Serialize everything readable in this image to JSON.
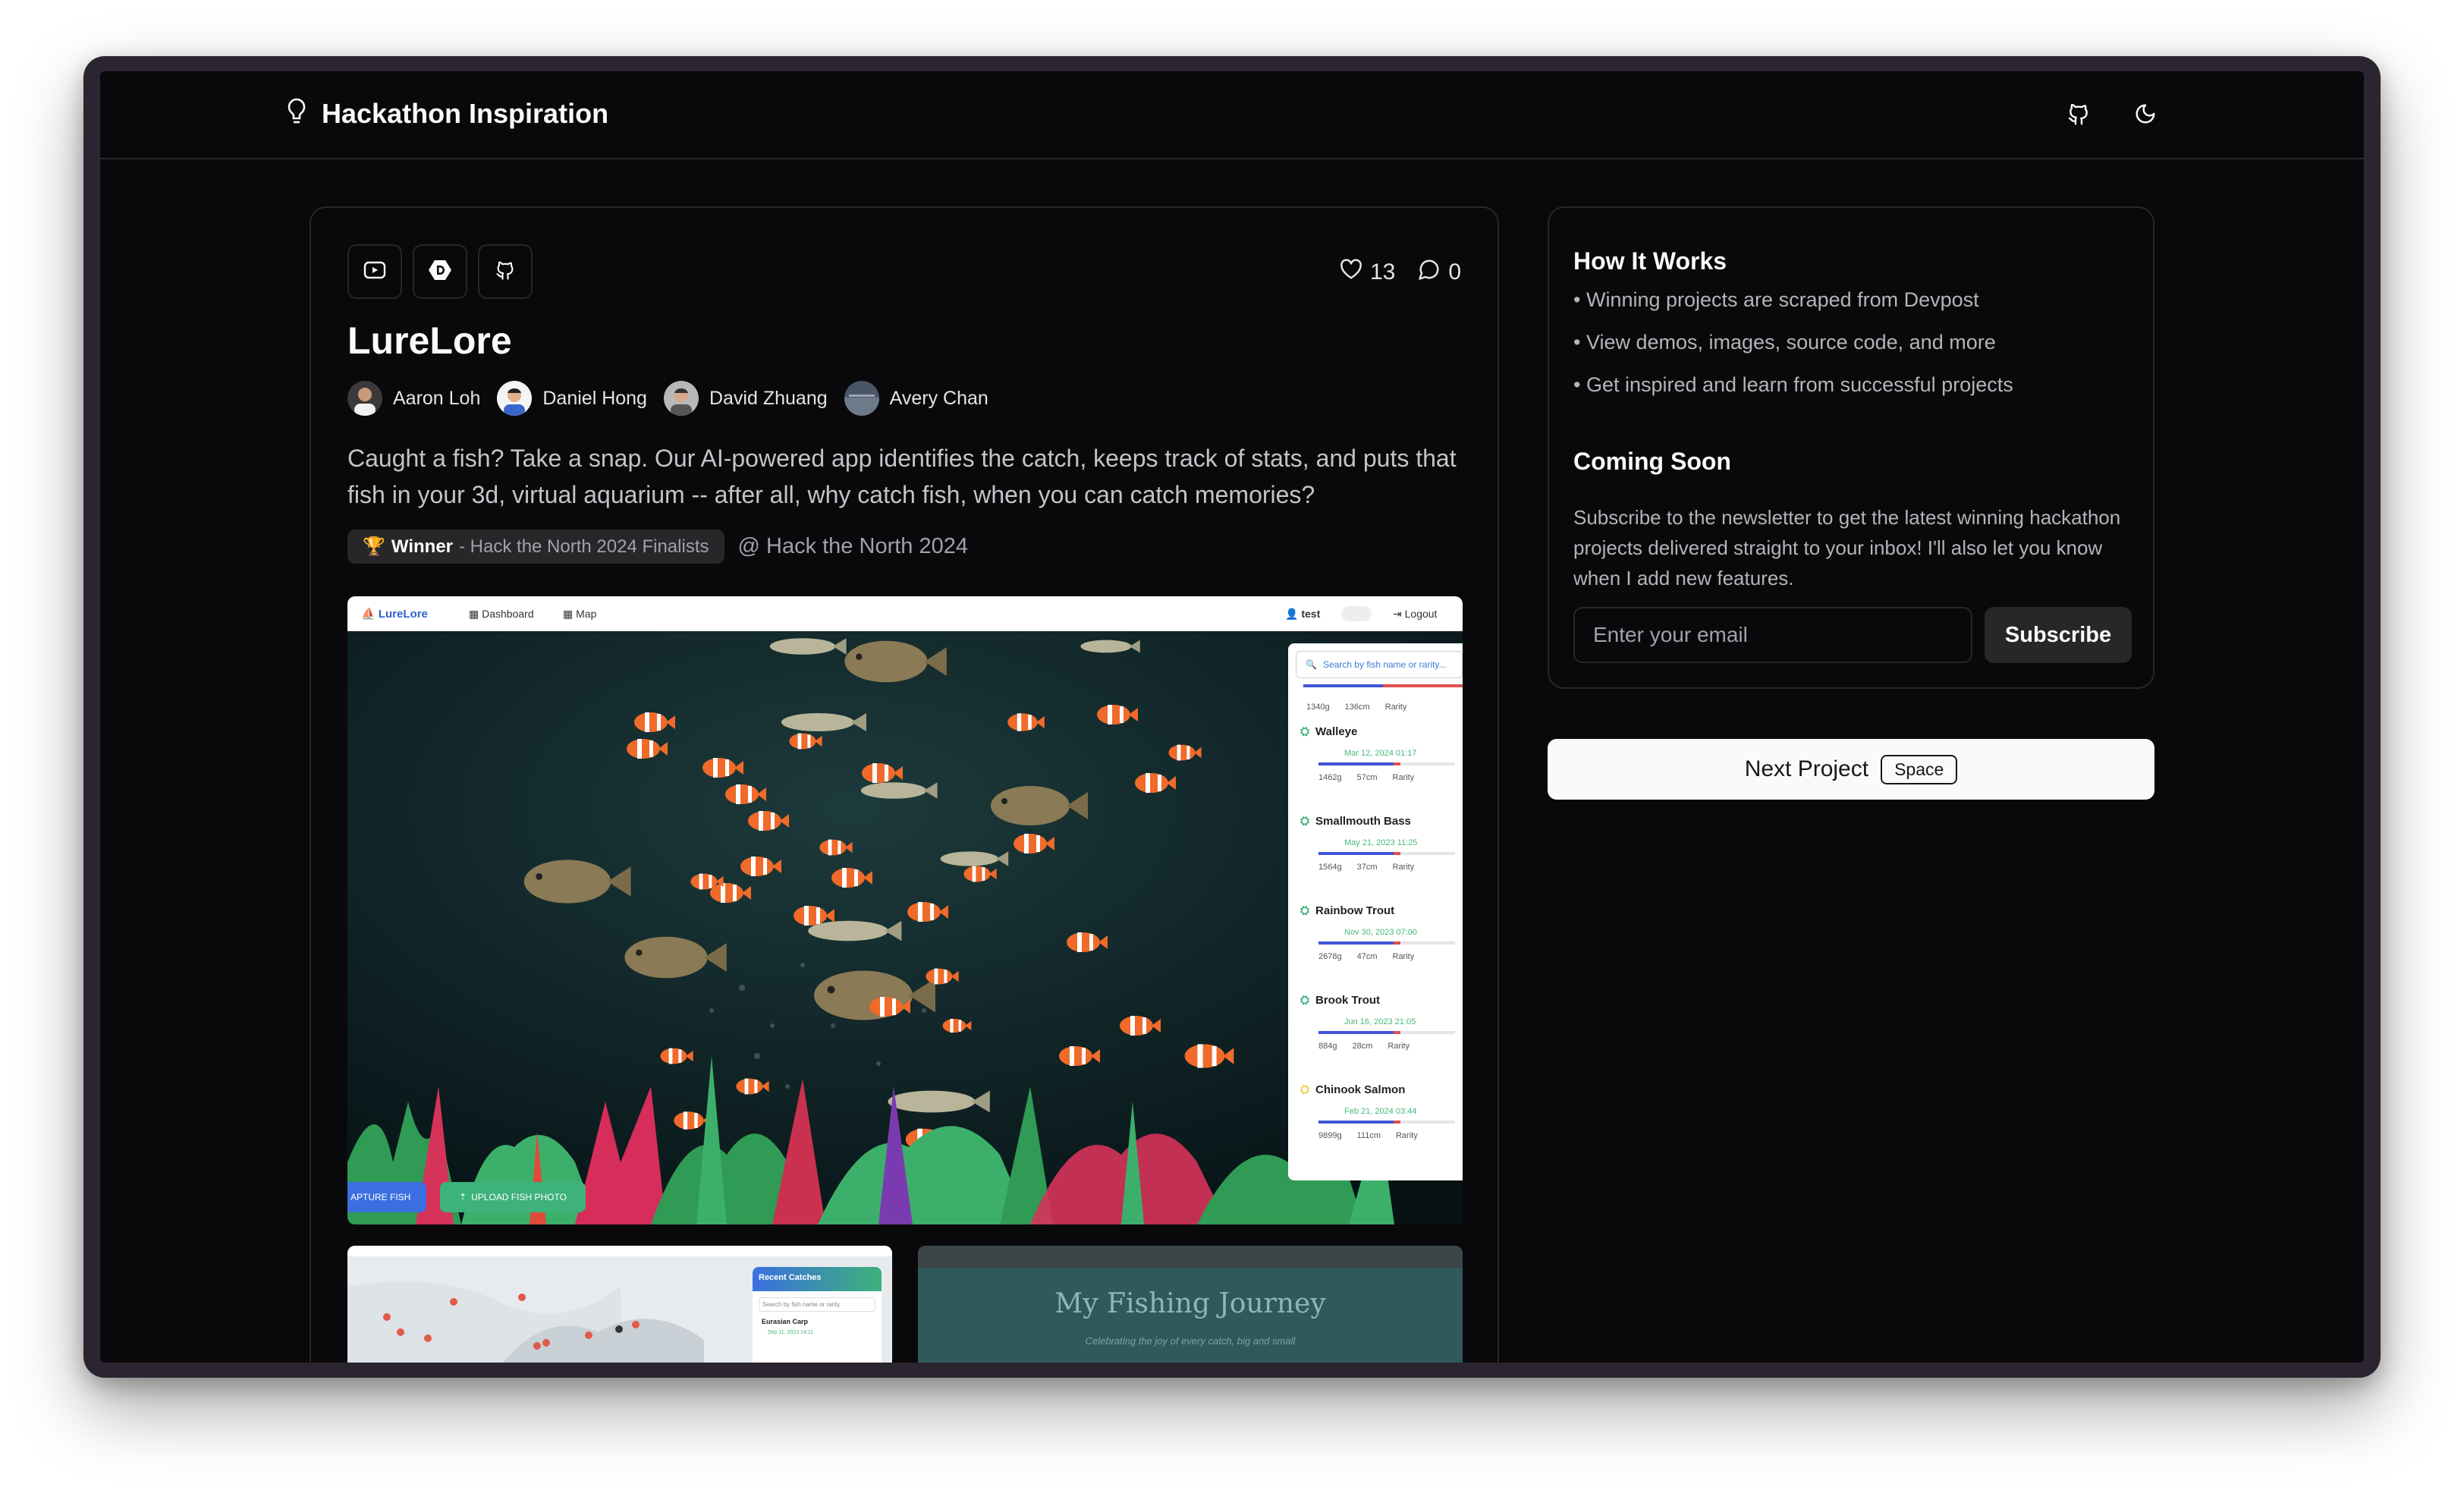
{
  "header": {
    "title": "Hackathon Inspiration"
  },
  "project": {
    "title": "LureLore",
    "likes": "13",
    "comments": "0",
    "team": [
      {
        "name": "Aaron Loh"
      },
      {
        "name": "Daniel Hong"
      },
      {
        "name": "David Zhuang"
      },
      {
        "name": "Avery Chan"
      }
    ],
    "description": "Caught a fish? Take a snap. Our AI-powered app identifies the catch, keeps track of stats, and puts that fish in your 3d, virtual aquarium -- after all, why catch fish, when you can catch memories?",
    "award": {
      "label": "Winner",
      "detail": "- Hack the North 2024 Finalists"
    },
    "event": "@ Hack the North 2024"
  },
  "screenshot": {
    "app_name": "LureLore",
    "nav": [
      "Dashboard",
      "Map"
    ],
    "user": "test",
    "logout": "Logout",
    "search_placeholder": "Search by fish name or rarity...",
    "first_meta": [
      "1340g",
      "136cm",
      "Rarity"
    ],
    "catches": [
      {
        "name": "Walleye",
        "date": "Mar 12, 2024 01:17",
        "weight": "1462g",
        "length": "57cm",
        "rarity": "Rarity"
      },
      {
        "name": "Smallmouth Bass",
        "date": "May 21, 2023 11:25",
        "weight": "1564g",
        "length": "37cm",
        "rarity": "Rarity"
      },
      {
        "name": "Rainbow Trout",
        "date": "Nov 30, 2023 07:00",
        "weight": "2678g",
        "length": "47cm",
        "rarity": "Rarity"
      },
      {
        "name": "Brook Trout",
        "date": "Jun 16, 2023 21:05",
        "weight": "884g",
        "length": "28cm",
        "rarity": "Rarity"
      },
      {
        "name": "Chinook Salmon",
        "date": "Feb 21, 2024 03:44",
        "weight": "9899g",
        "length": "111cm",
        "rarity": "Rarity"
      }
    ],
    "capture_label": "APTURE FISH",
    "upload_label": "UPLOAD FISH PHOTO",
    "map_panel_title": "Recent Catches",
    "map_search": "Search by fish name or rarity",
    "map_catch": "Eurasian Carp",
    "map_catch_date": "Sep 11, 2023 14:11",
    "journey_title": "My Fishing Journey",
    "journey_sub": "Celebrating the joy of every catch, big and small"
  },
  "sidebar": {
    "how_title": "How It Works",
    "how_items": [
      "• Winning projects are scraped from Devpost",
      "• View demos, images, source code, and more",
      "• Get inspired and learn from successful projects"
    ],
    "soon_title": "Coming Soon",
    "soon_text": "Subscribe to the newsletter to get the latest winning hackathon projects delivered straight to your inbox! I'll also let you know when I add new features.",
    "email_placeholder": "Enter your email",
    "subscribe_label": "Subscribe",
    "next_label": "Next Project",
    "next_key": "Space"
  },
  "colors": {
    "background": "#09090b",
    "border": "#27272a",
    "accent_green": "#3db27a",
    "accent_blue": "#3b6fe0"
  }
}
